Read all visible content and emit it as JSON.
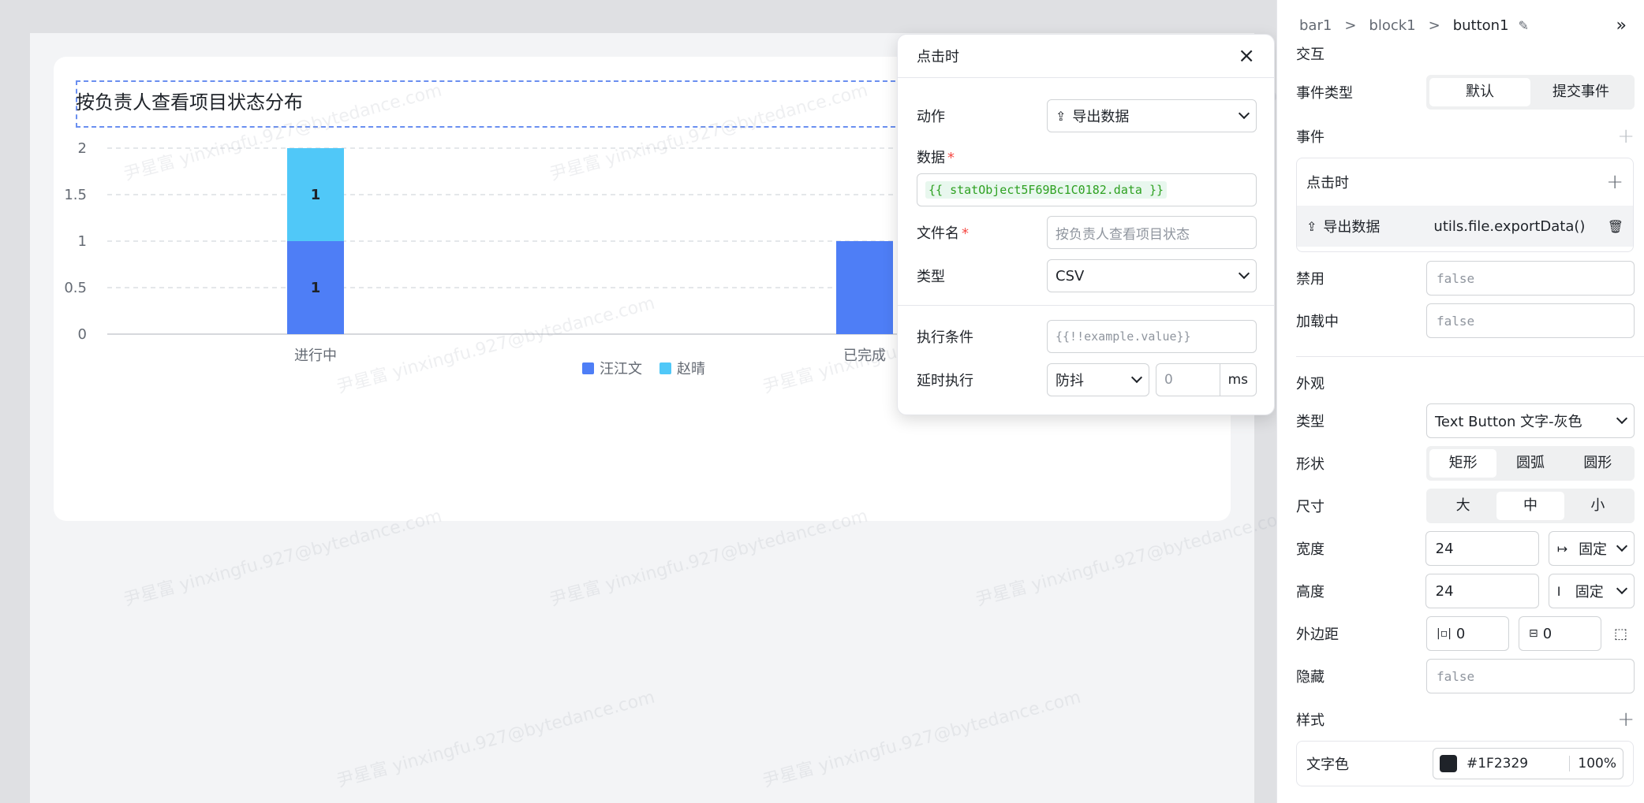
{
  "chart_card": {
    "title": "按负责人查看项目状态分布"
  },
  "chart_data": {
    "type": "bar",
    "stacked": true,
    "categories": [
      "进行中",
      "已完成"
    ],
    "series": [
      {
        "name": "汪江文",
        "values": [
          1,
          1
        ],
        "color": "#4e7ef6"
      },
      {
        "name": "赵晴",
        "values": [
          1,
          0
        ],
        "color": "#50c8f8"
      }
    ],
    "data_labels": [
      "1",
      "1"
    ],
    "ylim": [
      0,
      2
    ],
    "y_ticks": [
      "0",
      "0.5",
      "1",
      "1.5",
      "2"
    ],
    "grid": true,
    "legend_position": "bottom-center"
  },
  "popover": {
    "title": "点击时",
    "action_label": "动作",
    "action_value": "导出数据",
    "data_label": "数据",
    "data_value": "{{ statObject5F69Bc1C0182.data }}",
    "filename_label": "文件名",
    "filename_placeholder": "按负责人查看项目状态",
    "type_label": "类型",
    "type_value": "CSV",
    "condition_label": "执行条件",
    "condition_placeholder": "{{!!example.value}}",
    "delay_label": "延时执行",
    "delay_mode": "防抖",
    "delay_value": "0",
    "delay_unit": "ms"
  },
  "panel": {
    "breadcrumbs": [
      "bar1",
      "block1",
      "button1"
    ],
    "interaction_title": "交互",
    "event_type_label": "事件类型",
    "event_type_options": [
      "默认",
      "提交事件"
    ],
    "events_label": "事件",
    "on_click_label": "点击时",
    "event_item_label": "导出数据",
    "event_item_code": "utils.file.exportData()",
    "disabled_label": "禁用",
    "disabled_value": "false",
    "loading_label": "加载中",
    "loading_value": "false",
    "appearance_title": "外观",
    "type_label": "类型",
    "type_value": "Text Button  文字-灰色",
    "shape_label": "形状",
    "shape_options": [
      "矩形",
      "圆弧",
      "圆形"
    ],
    "size_label": "尺寸",
    "size_options": [
      "大",
      "中",
      "小"
    ],
    "width_label": "宽度",
    "width_value": "24",
    "width_mode": "固定",
    "height_label": "高度",
    "height_value": "24",
    "height_mode": "固定",
    "margin_label": "外边距",
    "margin_x": "0",
    "margin_y": "0",
    "hidden_label": "隐藏",
    "hidden_value": "false",
    "style_label": "样式",
    "text_color_label": "文字色",
    "text_color_value": "#1F2329",
    "text_color_opacity": "100%"
  },
  "watermark_text": "尹星富 yinxingfu.927@bytedance.com"
}
